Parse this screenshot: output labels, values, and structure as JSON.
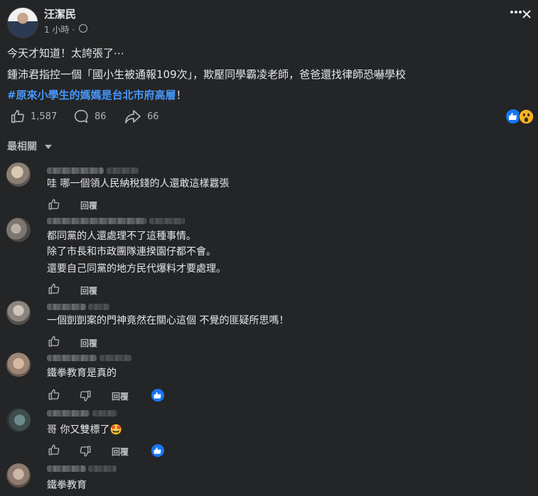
{
  "post": {
    "author": "汪潔民",
    "time": "1 小時 ·",
    "line1": "今天才知道！太誇張了⋯",
    "line2": "鍾沛君指控一個「國小生被通報109次」，欺壓同學霸凌老師，爸爸還找律師恐嚇學校",
    "hashtag": "#原來小學生的媽媽是台北市府高層",
    "hashtag_suffix": "！",
    "likes": "1,587",
    "comments": "86",
    "shares": "66"
  },
  "sort_label": "最相關",
  "reply_label": "回覆",
  "comments": [
    {
      "lines": [
        "哇 哪一個領人民納稅錢的人還敢這樣囂張"
      ]
    },
    {
      "lines": [
        "都同黨的人還處理不了這種事情。",
        "除了市長和市政團隊連揆園仔都不會。",
        "還要自己同黨的地方民代爆料才要處理。"
      ]
    },
    {
      "lines": [
        "一個剴剴案的門神竟然在關心這個 不覺的匪疑所思嗎！"
      ]
    },
    {
      "lines": [
        "鐵拳教育是真的"
      ]
    },
    {
      "lines": [
        "哥 你又雙標了🤩"
      ]
    },
    {
      "lines": [
        "鐵拳教育"
      ]
    }
  ],
  "colors": {
    "background": "#242526",
    "text": "#e4e6eb",
    "secondary": "#b0b3b8",
    "link": "#4599ff",
    "like_blue": "#1877f2"
  },
  "icons": [
    "globe-icon",
    "more-icon",
    "close-icon",
    "like-icon",
    "comment-icon",
    "share-icon",
    "chevron-down-icon",
    "like-reaction-icon",
    "wow-reaction-icon",
    "dislike-icon"
  ]
}
